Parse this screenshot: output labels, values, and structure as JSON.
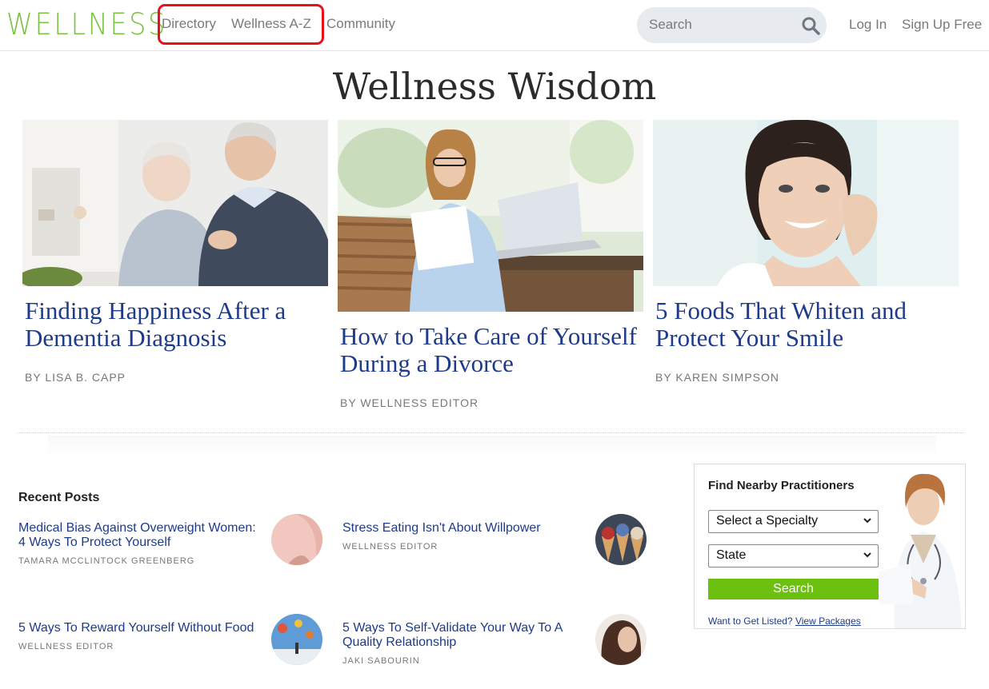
{
  "header": {
    "logo": "WELLNESS",
    "nav": [
      "Directory",
      "Wellness A-Z",
      "Community"
    ],
    "search_placeholder": "Search",
    "login": "Log In",
    "signup": "Sign Up Free"
  },
  "wisdom": {
    "title": "Wellness Wisdom",
    "cards": [
      {
        "title": "Finding Happiness After a Dementia Diagnosis",
        "byline": "BY LISA B. CAPP"
      },
      {
        "title": "How to Take Care of Yourself During a Divorce",
        "byline": "BY WELLNESS EDITOR"
      },
      {
        "title": "5 Foods That Whiten and Protect Your Smile",
        "byline": "BY KAREN SIMPSON"
      }
    ]
  },
  "recent": {
    "title": "Recent Posts",
    "posts": [
      {
        "title": "Medical Bias Against Overweight Women: 4 Ways To Protect Yourself",
        "author": "TAMARA MCCLINTOCK GREENBERG"
      },
      {
        "title": "Stress Eating Isn't About Willpower",
        "author": "WELLNESS EDITOR"
      },
      {
        "title": "5 Ways To Reward Yourself Without Food",
        "author": "WELLNESS EDITOR"
      },
      {
        "title": "5 Ways To Self-Validate Your Way To A Quality Relationship",
        "author": "JAKI SABOURIN"
      }
    ]
  },
  "widget": {
    "title": "Find Nearby Practitioners",
    "specialty": "Select a Specialty",
    "state": "State",
    "button": "Search",
    "footer_text": "Want to Get Listed?",
    "footer_link": "View Packages"
  },
  "colors": {
    "brand_green": "#7cc242",
    "link_blue": "#1d3b8a",
    "button_green": "#6cc00f",
    "highlight_red": "#e8111b"
  }
}
